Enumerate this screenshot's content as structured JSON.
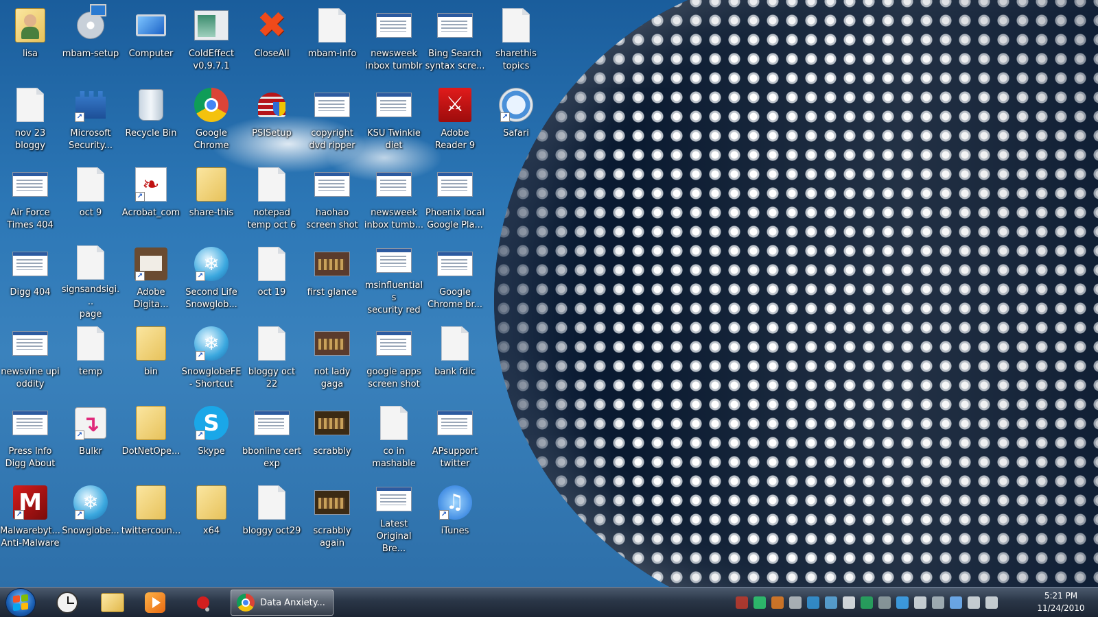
{
  "desktop": {
    "icons": [
      {
        "label": "lisa",
        "icon": "user-folder-icon",
        "shortcut": false
      },
      {
        "label": "mbam-setup",
        "icon": "installer-icon",
        "shortcut": false
      },
      {
        "label": "Computer",
        "icon": "computer-icon",
        "shortcut": false
      },
      {
        "label": "ColdEffect\nv0.9.7.1",
        "icon": "program-window-icon",
        "shortcut": false
      },
      {
        "label": "CloseAll",
        "icon": "red-x-icon",
        "shortcut": false
      },
      {
        "label": "mbam-info",
        "icon": "document-icon",
        "shortcut": false
      },
      {
        "label": "newsweek\ninbox tumblr",
        "icon": "screenshot-thumbnail-icon",
        "shortcut": false
      },
      {
        "label": "Bing Search\nsyntax scre...",
        "icon": "screenshot-thumbnail-icon",
        "shortcut": false
      },
      {
        "label": "sharethis\ntopics",
        "icon": "document-icon",
        "shortcut": false
      },
      {
        "label": "nov 23\nbloggy",
        "icon": "document-icon",
        "shortcut": false
      },
      {
        "label": "Microsoft\nSecurity...",
        "icon": "castle-shield-icon",
        "shortcut": true
      },
      {
        "label": "Recycle Bin",
        "icon": "recycle-bin-icon",
        "shortcut": false
      },
      {
        "label": "Google\nChrome",
        "icon": "chrome-icon",
        "shortcut": false
      },
      {
        "label": "PSISetup",
        "icon": "shield-installer-icon",
        "shortcut": false
      },
      {
        "label": "copyright\ndvd ripper",
        "icon": "screenshot-thumbnail-icon",
        "shortcut": false
      },
      {
        "label": "KSU Twinkie\ndiet",
        "icon": "screenshot-thumbnail-icon",
        "shortcut": false
      },
      {
        "label": "Adobe\nReader 9",
        "icon": "adobe-reader-icon",
        "shortcut": false
      },
      {
        "label": "Safari",
        "icon": "safari-compass-icon",
        "shortcut": true
      },
      {
        "label": "Air Force\nTimes 404",
        "icon": "screenshot-thumbnail-icon",
        "shortcut": false
      },
      {
        "label": "oct 9",
        "icon": "document-icon",
        "shortcut": false
      },
      {
        "label": "Acrobat_com",
        "icon": "acrobat-icon",
        "shortcut": true
      },
      {
        "label": "share-this",
        "icon": "folder-icon",
        "shortcut": false
      },
      {
        "label": "notepad\ntemp oct 6",
        "icon": "document-icon",
        "shortcut": false
      },
      {
        "label": "haohao\nscreen shot",
        "icon": "screenshot-thumbnail-icon",
        "shortcut": false
      },
      {
        "label": "newsweek\ninbox tumb...",
        "icon": "screenshot-thumbnail-icon",
        "shortcut": false
      },
      {
        "label": "Phoenix local\nGoogle Pla...",
        "icon": "screenshot-thumbnail-icon",
        "shortcut": false
      },
      {
        "label": "Digg 404",
        "icon": "screenshot-thumbnail-icon",
        "shortcut": false
      },
      {
        "label": "signsandsigi...\npage",
        "icon": "document-icon",
        "shortcut": false
      },
      {
        "label": "Adobe\nDigita...",
        "icon": "adobe-digital-editions-icon",
        "shortcut": true
      },
      {
        "label": "Second Life\nSnowglob...",
        "icon": "snowglobe-icon",
        "shortcut": true
      },
      {
        "label": "oct 19",
        "icon": "document-icon",
        "shortcut": false
      },
      {
        "label": "first glance",
        "icon": "photo-thumbnail-icon",
        "shortcut": false
      },
      {
        "label": "msinfluentials\nsecurity red",
        "icon": "screenshot-thumbnail-icon",
        "shortcut": false
      },
      {
        "label": "Google\nChrome br...",
        "icon": "screenshot-thumbnail-icon",
        "shortcut": false
      },
      {
        "label": "newsvine upi\noddity",
        "icon": "screenshot-thumbnail-icon",
        "shortcut": false
      },
      {
        "label": "temp",
        "icon": "document-icon",
        "shortcut": false
      },
      {
        "label": "bin",
        "icon": "folder-icon",
        "shortcut": false
      },
      {
        "label": "SnowglobeFE\n- Shortcut",
        "icon": "snowglobe-icon",
        "shortcut": true
      },
      {
        "label": "bloggy oct\n22",
        "icon": "document-icon",
        "shortcut": false
      },
      {
        "label": "not lady\ngaga",
        "icon": "photo-thumbnail-icon",
        "shortcut": false
      },
      {
        "label": "google apps\nscreen shot",
        "icon": "screenshot-thumbnail-icon",
        "shortcut": false
      },
      {
        "label": "bank fdic",
        "icon": "document-icon",
        "shortcut": false
      },
      {
        "label": "Press Info\nDigg About",
        "icon": "screenshot-thumbnail-icon",
        "shortcut": false
      },
      {
        "label": "Bulkr",
        "icon": "bulkr-icon",
        "shortcut": true
      },
      {
        "label": "DotNetOpe...",
        "icon": "folder-icon",
        "shortcut": false
      },
      {
        "label": "Skype",
        "icon": "skype-icon",
        "shortcut": true
      },
      {
        "label": "bbonline cert\nexp",
        "icon": "screenshot-thumbnail-icon",
        "shortcut": false
      },
      {
        "label": "scrabbly",
        "icon": "game-board-thumbnail-icon",
        "shortcut": false
      },
      {
        "label": "co in\nmashable",
        "icon": "document-icon",
        "shortcut": false
      },
      {
        "label": "APsupport\ntwitter",
        "icon": "screenshot-thumbnail-icon",
        "shortcut": false
      },
      {
        "label": "Malwarebyt...\nAnti-Malware",
        "icon": "malwarebytes-icon",
        "shortcut": true
      },
      {
        "label": "Snowglobe...",
        "icon": "snowglobe-icon",
        "shortcut": true
      },
      {
        "label": "twittercoun...",
        "icon": "folder-icon",
        "shortcut": false
      },
      {
        "label": "x64",
        "icon": "folder-icon",
        "shortcut": false
      },
      {
        "label": "bloggy oct29",
        "icon": "document-icon",
        "shortcut": false
      },
      {
        "label": "scrabbly\nagain",
        "icon": "game-board-thumbnail-icon",
        "shortcut": false
      },
      {
        "label": "Latest\nOriginal Bre...",
        "icon": "screenshot-thumbnail-icon",
        "shortcut": false
      },
      {
        "label": "iTunes",
        "icon": "itunes-icon",
        "shortcut": true
      }
    ]
  },
  "taskbar": {
    "start_icon": "windows-start-icon",
    "pinned": [
      {
        "name": "clock-app",
        "icon": "clock-icon"
      },
      {
        "name": "windows-explorer",
        "icon": "folder-icon"
      },
      {
        "name": "media-player",
        "icon": "media-player-icon"
      },
      {
        "name": "pushpin-app",
        "icon": "pushpin-icon"
      }
    ],
    "active_task": {
      "label": "Data Anxiety...",
      "icon": "chrome-icon"
    },
    "tray_count": 15,
    "clock": {
      "time": "5:21 PM",
      "date": "11/24/2010"
    }
  },
  "colors": {
    "accent_blue": "#2c77b6",
    "taskbar": "#2a3647",
    "label_text": "#ffffff"
  }
}
